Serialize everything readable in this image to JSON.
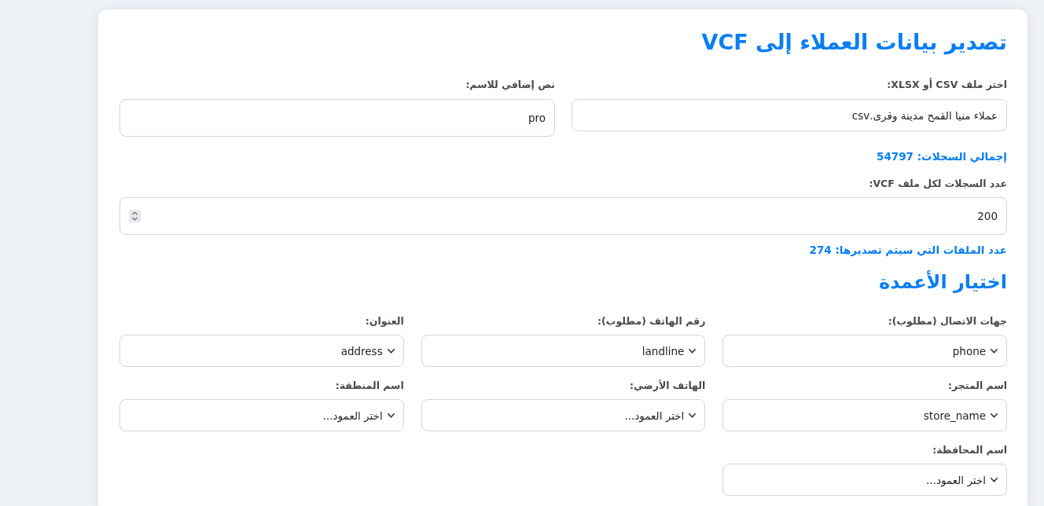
{
  "title": "تصدير بيانات العملاء إلى VCF",
  "source_fields": [
    {
      "kind": "file",
      "label": "اختر ملف CSV أو XLSX:",
      "value": "عملاء منيا القمح مدينة وقرى.csv"
    },
    {
      "kind": "text",
      "label": "نص إضافي للاسم:",
      "value": "pro"
    }
  ],
  "total_records": "إجمالي السجلات: 54797",
  "records_per_file": {
    "label": "عدد السجلات لكل ملف VCF:",
    "value": "200"
  },
  "files_to_export": "عدد الملفات التي سيتم تصديرها: 274",
  "columns_section": {
    "heading": "اختيار الأعمدة",
    "selects": [
      {
        "label": "جهات الاتصال (مطلوب):",
        "value": "phone"
      },
      {
        "label": "رقم الهاتف (مطلوب):",
        "value": "landline"
      },
      {
        "label": "العنوان:",
        "value": "address"
      },
      {
        "label": "اسم المتجر:",
        "value": "store_name"
      },
      {
        "label": "الهاتف الأرضي:",
        "value": "اختر العمود..."
      },
      {
        "label": "اسم المنطقة:",
        "value": "اختر العمود..."
      },
      {
        "label": "اسم المحافظة:",
        "value": "اختر العمود..."
      }
    ]
  }
}
